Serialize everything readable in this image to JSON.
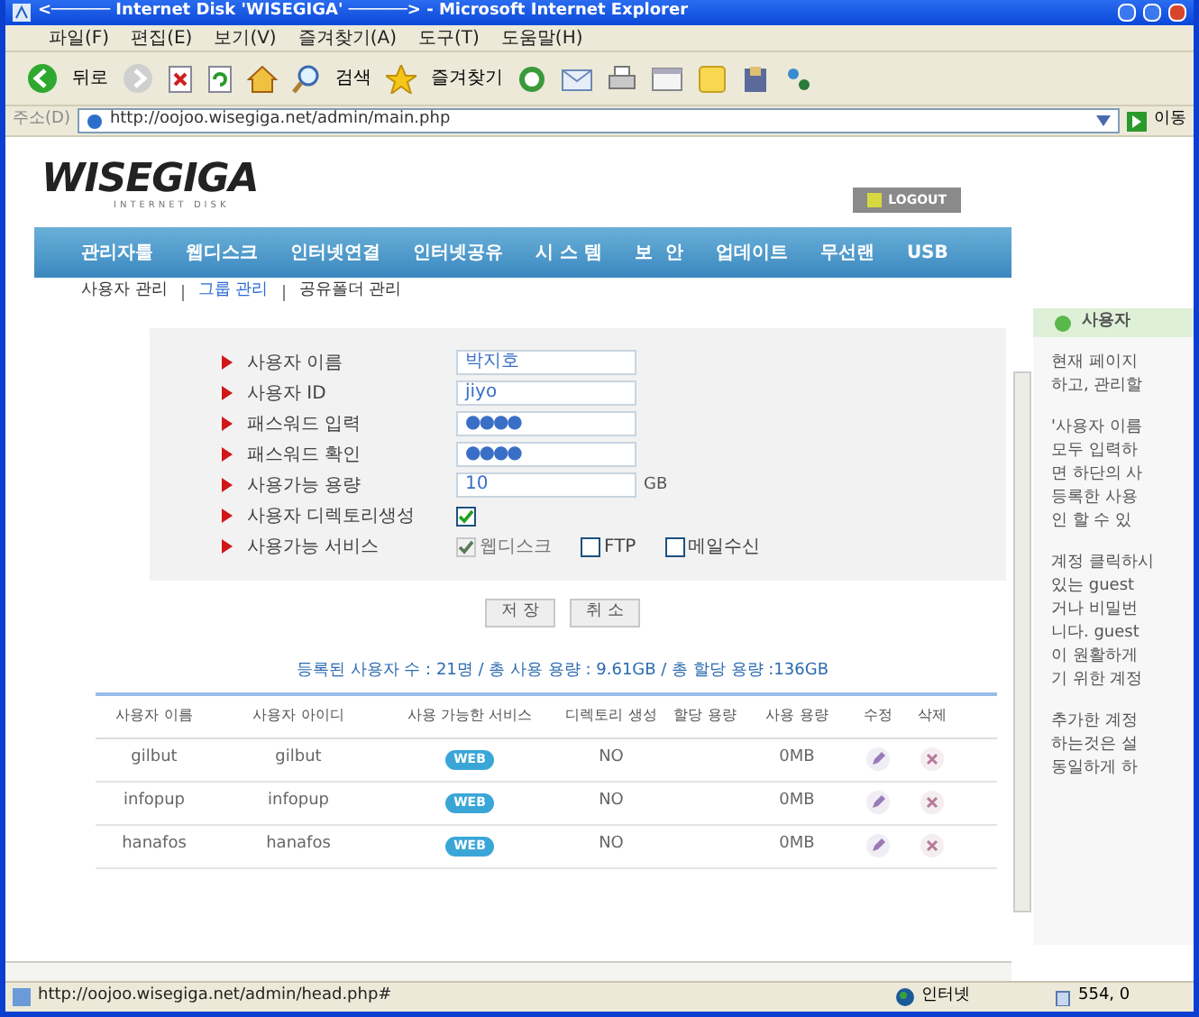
{
  "window": {
    "title": "<────── Internet Disk 'WISEGIGA' ──────> - Microsoft Internet Explorer"
  },
  "menu_bar": [
    "파일(F)",
    "편집(E)",
    "보기(V)",
    "즐겨찾기(A)",
    "도구(T)",
    "도움말(H)"
  ],
  "toolbar": {
    "back": "뒤로",
    "search": "검색",
    "favorites": "즐겨찾기"
  },
  "address_bar": {
    "label": "주소(D)",
    "value": "http://oojoo.wisegiga.net/admin/main.php",
    "go": "이동"
  },
  "page": {
    "logo": "WISEGIGA",
    "logo_sub": "INTERNET DISK",
    "logout": "LOGOUT",
    "nav": [
      "관리자툴",
      "웹디스크",
      "인터넷연결",
      "인터넷공유",
      "시 스 템",
      "보  안",
      "업데이트",
      "무선랜",
      "USB"
    ],
    "sub_nav": [
      {
        "label": "사용자 관리",
        "selected": false
      },
      {
        "label": "그룹 관리",
        "selected": true
      },
      {
        "label": "공유폴더 관리",
        "selected": false
      }
    ],
    "form": {
      "fields": [
        {
          "kind": "text",
          "label": "사용자 이름",
          "value": "박지호"
        },
        {
          "kind": "text",
          "label": "사용자 ID",
          "value": "jiyo"
        },
        {
          "kind": "password",
          "label": "패스워드 입력",
          "value": "●●●●"
        },
        {
          "kind": "password",
          "label": "패스워드 확인",
          "value": "●●●●"
        },
        {
          "kind": "size",
          "label": "사용가능 용량",
          "value": "10",
          "unit": "GB"
        },
        {
          "kind": "checkbox",
          "label": "사용자 디렉토리생성",
          "checked": true
        },
        {
          "kind": "services",
          "label": "사용가능 서비스",
          "options": [
            {
              "label": "웹디스크",
              "checked": true,
              "disabled": true
            },
            {
              "label": "FTP",
              "checked": false,
              "disabled": false
            },
            {
              "label": "메일수신",
              "checked": false,
              "disabled": false
            }
          ]
        }
      ],
      "buttons": [
        "저 장",
        "취 소"
      ]
    },
    "summary": "등록된 사용자 수 : 21명 / 총 사용 용량 : 9.61GB / 총 할당 용량 :136GB",
    "table": {
      "columns": [
        "사용자 이름",
        "사용자 아이디",
        "사용 가능한 서비스",
        "디렉토리 생성",
        "할당 용량",
        "사용 용량",
        "수정",
        "삭제"
      ],
      "rows": [
        {
          "name": "gilbut",
          "id": "gilbut",
          "service": "WEB",
          "directory": "NO",
          "used": "0MB"
        },
        {
          "name": "infopup",
          "id": "infopup",
          "service": "WEB",
          "directory": "NO",
          "used": "0MB"
        },
        {
          "name": "hanafos",
          "id": "hanafos",
          "service": "WEB",
          "directory": "NO",
          "used": "0MB"
        }
      ]
    },
    "help_panel": {
      "title": "사용자",
      "paragraphs": [
        [
          "현재 페이지",
          "하고, 관리할"
        ],
        [
          "'사용자 이름",
          "모두 입력하",
          "면 하단의 사",
          "등록한 사용",
          "인 할 수 있"
        ],
        [
          "계정 클릭하시",
          "있는 guest",
          "거나 비밀번",
          "니다. guest",
          "이 원활하게",
          "기 위한 계정"
        ],
        [
          "추가한 계정",
          "하는것은 설",
          "동일하게 하"
        ]
      ]
    }
  },
  "status_bar": {
    "url": "http://oojoo.wisegiga.net/admin/head.php#",
    "zone": "인터넷",
    "count": "554, 0"
  }
}
